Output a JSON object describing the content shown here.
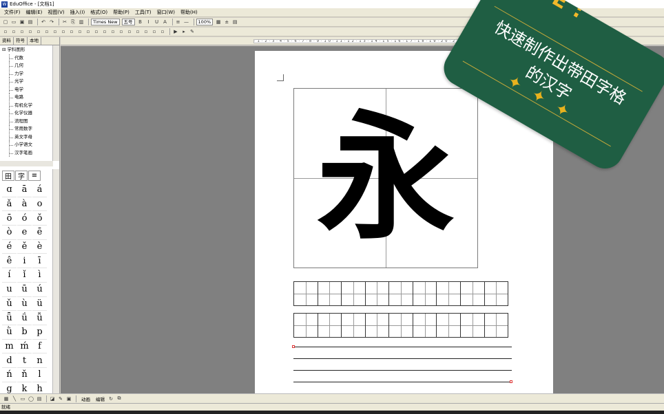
{
  "window": {
    "title": "EduOffice - [文档1]",
    "logo": "W"
  },
  "menu": [
    "文件(F)",
    "编辑(E)",
    "视图(V)",
    "插入(I)",
    "格式(O)",
    "帮助(P)",
    "工具(T)",
    "窗口(W)",
    "帮助(H)"
  ],
  "toolbar1": {
    "font": "Times New",
    "size": "五号",
    "zoom": "100%"
  },
  "tree": {
    "tabs": [
      "资料",
      "符号",
      "本地"
    ],
    "root": "学科图形",
    "items": [
      "代数",
      "几何",
      "力学",
      "光学",
      "电学",
      "电路",
      "有机化学",
      "化学仪器",
      "流程图",
      "常用数字",
      "英文字母",
      "小学语文",
      "汉字笔画"
    ]
  },
  "symbols": {
    "tabs": [
      "田",
      "字",
      "≡"
    ],
    "grid": [
      "ɑ",
      "ā",
      "á",
      "ǎ",
      "à",
      "o",
      "ō",
      "ó",
      "ǒ",
      "ò",
      "e",
      "ē",
      "é",
      "ě",
      "è",
      "ê",
      "i",
      "ī",
      "í",
      "ǐ",
      "ì",
      "u",
      "ū",
      "ú",
      "ǔ",
      "ù",
      "ü",
      "ǖ",
      "ǘ",
      "ǚ",
      "ǜ",
      "b",
      "p",
      "m",
      "ḿ",
      "f",
      "d",
      "t",
      "n",
      "ń",
      "ň",
      "l",
      "g",
      "k",
      "h"
    ]
  },
  "document": {
    "main_char": "永"
  },
  "bottom_toolbar": {
    "btn1": "动画",
    "btn2": "编辑"
  },
  "status": {
    "text": "就绪"
  },
  "note": {
    "heading": "OTE :",
    "line1": "快速制作出带田字格",
    "line2": "的汉字",
    "colors": {
      "bg": "#1f5e43",
      "accent": "#e8b21e"
    }
  }
}
